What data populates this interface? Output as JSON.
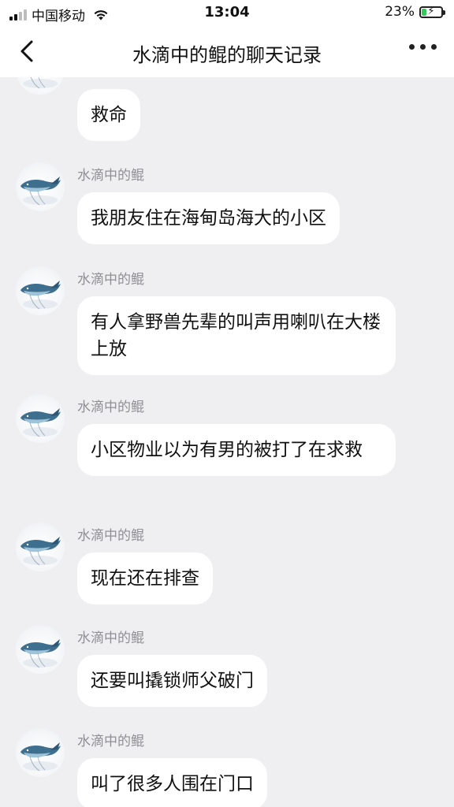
{
  "status_bar": {
    "carrier": "中国移动",
    "time": "13:04",
    "battery": "23%",
    "battery_level": 0.23,
    "signal_icon": "signal-icon",
    "wifi_icon": "wifi-icon"
  },
  "nav": {
    "title": "水滴中的鲲的聊天记录",
    "back_icon": "chevron-left-icon",
    "more_icon": "more-dots-icon"
  },
  "messages": [
    {
      "sender": "",
      "text": "救命"
    },
    {
      "sender": "水滴中的鲲",
      "text": "我朋友住在海甸岛海大的小区"
    },
    {
      "sender": "水滴中的鲲",
      "text": "有人拿野兽先辈的叫声用喇叭在大楼上放"
    },
    {
      "sender": "水滴中的鲲",
      "text": "小区物业以为有男的被打了在求救"
    },
    {
      "sender": "水滴中的鲲",
      "text": "现在还在排查"
    },
    {
      "sender": "水滴中的鲲",
      "text": "还要叫撬锁师父破门"
    },
    {
      "sender": "水滴中的鲲",
      "text": "叫了很多人围在门口"
    }
  ],
  "colors": {
    "background": "#efeff1",
    "bubble": "#ffffff",
    "sender_name": "#8f8f94",
    "battery_fill": "#34c759"
  }
}
